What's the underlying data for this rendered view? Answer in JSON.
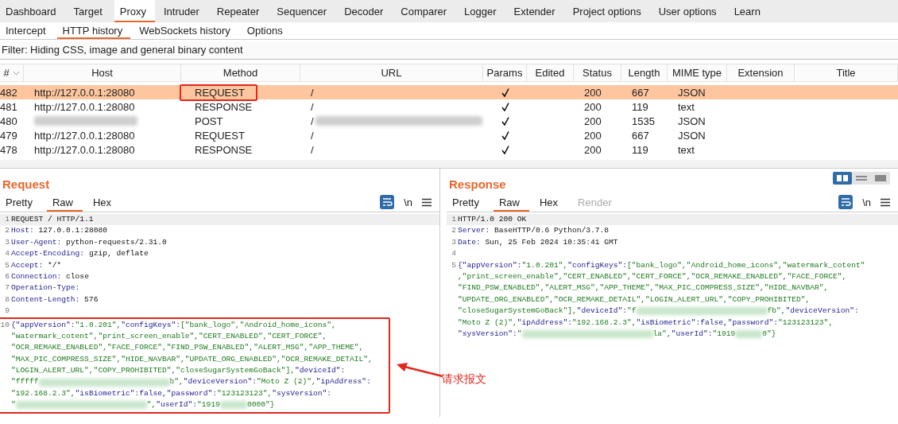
{
  "tabs": [
    {
      "label": "Dashboard",
      "selected": false
    },
    {
      "label": "Target",
      "selected": false
    },
    {
      "label": "Proxy",
      "selected": true
    },
    {
      "label": "Intruder",
      "selected": false
    },
    {
      "label": "Repeater",
      "selected": false
    },
    {
      "label": "Sequencer",
      "selected": false
    },
    {
      "label": "Decoder",
      "selected": false
    },
    {
      "label": "Comparer",
      "selected": false
    },
    {
      "label": "Logger",
      "selected": false
    },
    {
      "label": "Extender",
      "selected": false
    },
    {
      "label": "Project options",
      "selected": false
    },
    {
      "label": "User options",
      "selected": false
    },
    {
      "label": "Learn",
      "selected": false
    }
  ],
  "subtabs": [
    {
      "label": "Intercept",
      "selected": false
    },
    {
      "label": "HTTP history",
      "selected": true
    },
    {
      "label": "WebSockets history",
      "selected": false
    },
    {
      "label": "Options",
      "selected": false
    }
  ],
  "filter": "Filter: Hiding CSS, image and general binary content",
  "table": {
    "columns": [
      "#",
      "Host",
      "Method",
      "URL",
      "Params",
      "Edited",
      "Status",
      "Length",
      "MIME type",
      "Extension",
      "Title"
    ],
    "rows": [
      {
        "num": "482",
        "host": "http://127.0.0.1:28080",
        "method": "REQUEST",
        "url": "/",
        "params": true,
        "status": "200",
        "length": "667",
        "mime": "JSON",
        "selected": true,
        "method_boxed": true
      },
      {
        "num": "481",
        "host": "http://127.0.0.1:28080",
        "method": "RESPONSE",
        "url": "/",
        "params": true,
        "status": "200",
        "length": "119",
        "mime": "text",
        "selected": false,
        "method_boxed": false
      },
      {
        "num": "480",
        "host_blurred": true,
        "method": "POST",
        "url": "/",
        "url_blurred": true,
        "params": true,
        "status": "200",
        "length": "1535",
        "mime": "JSON",
        "selected": false,
        "method_boxed": false
      },
      {
        "num": "479",
        "host": "http://127.0.0.1:28080",
        "method": "REQUEST",
        "url": "/",
        "params": true,
        "status": "200",
        "length": "667",
        "mime": "JSON",
        "selected": false,
        "method_boxed": false
      },
      {
        "num": "478",
        "host": "http://127.0.0.1:28080",
        "method": "RESPONSE",
        "url": "/",
        "params": true,
        "status": "200",
        "length": "119",
        "mime": "text",
        "selected": false,
        "method_boxed": false
      }
    ]
  },
  "request": {
    "title": "Request",
    "tabs": [
      {
        "label": "Pretty",
        "selected": false,
        "disabled": false
      },
      {
        "label": "Raw",
        "selected": true,
        "disabled": false
      },
      {
        "label": "Hex",
        "selected": false,
        "disabled": false
      }
    ],
    "newline_toggle": "\\n",
    "annotation": "请求报文",
    "lines": [
      {
        "n": "1",
        "highlighted": true,
        "segs": [
          {
            "t": "REQUEST / HTTP/1.1",
            "kind": "plain"
          }
        ]
      },
      {
        "n": "2",
        "highlighted": false,
        "segs": [
          {
            "t": "Host:",
            "kind": "key"
          },
          {
            "t": " 127.0.0.1:28080",
            "kind": "plain"
          }
        ]
      },
      {
        "n": "3",
        "highlighted": false,
        "segs": [
          {
            "t": "User-Agent:",
            "kind": "key"
          },
          {
            "t": " python-requests/2.31.0",
            "kind": "plain"
          }
        ]
      },
      {
        "n": "4",
        "highlighted": false,
        "segs": [
          {
            "t": "Accept-Encoding:",
            "kind": "key"
          },
          {
            "t": " gzip, deflate",
            "kind": "plain"
          }
        ]
      },
      {
        "n": "5",
        "highlighted": false,
        "segs": [
          {
            "t": "Accept:",
            "kind": "key"
          },
          {
            "t": " */*",
            "kind": "plain"
          }
        ]
      },
      {
        "n": "6",
        "highlighted": false,
        "segs": [
          {
            "t": "Connection:",
            "kind": "key"
          },
          {
            "t": " close",
            "kind": "plain"
          }
        ]
      },
      {
        "n": "7",
        "highlighted": false,
        "segs": [
          {
            "t": "Operation-Type:",
            "kind": "key"
          }
        ]
      },
      {
        "n": "8",
        "highlighted": false,
        "segs": [
          {
            "t": "Content-Length:",
            "kind": "key"
          },
          {
            "t": " 576",
            "kind": "plain"
          }
        ]
      },
      {
        "n": "9",
        "highlighted": false
      },
      {
        "n": "10",
        "highlighted": false,
        "boxed": true,
        "segs": [
          {
            "t": "{\"appVersion\":",
            "kind": "key"
          },
          {
            "t": "\"1.0.201\",",
            "kind": "str"
          },
          {
            "t": "\"configKeys\":",
            "kind": "key"
          },
          {
            "t": "[\"bank_logo\",\"Android_home_icons\",",
            "kind": "str"
          }
        ]
      },
      {
        "highlighted": false,
        "boxed": true,
        "segs": [
          {
            "t": "\"watermark_cotent\",\"print_screen_enable\",\"CERT_ENABLED\",\"CERT_FORCE\",",
            "kind": "str"
          }
        ]
      },
      {
        "highlighted": false,
        "boxed": true,
        "segs": [
          {
            "t": "\"OCR_REMAKE_ENABLED\",\"FACE_FORCE\",\"FIND_PSW_ENABLED\",\"ALERT_MSG\",\"APP_THEME\",",
            "kind": "str"
          }
        ]
      },
      {
        "highlighted": false,
        "boxed": true,
        "segs": [
          {
            "t": "\"MAX_PIC_COMPRESS_SIZE\",\"HIDE_NAVBAR\",\"UPDATE_ORG_ENABLED\",\"OCR_REMAKE_DETAIL\",",
            "kind": "str"
          }
        ]
      },
      {
        "highlighted": false,
        "boxed": true,
        "segs": [
          {
            "t": "\"LOGIN_ALERT_URL\",\"COPY_PROHIBITED\",\"closeSugarSystemGoBack\"],",
            "kind": "str"
          },
          {
            "t": "\"deviceId\":",
            "kind": "key"
          }
        ]
      },
      {
        "highlighted": false,
        "boxed": true,
        "segs": [
          {
            "t": "\"fffff",
            "kind": "str"
          },
          {
            "kind": "redact"
          },
          {
            "t": "b\",",
            "kind": "str"
          },
          {
            "t": "\"deviceVersion\":",
            "kind": "key"
          },
          {
            "t": "\"Moto Z (2)\",",
            "kind": "str"
          },
          {
            "t": "\"ipAddress\":",
            "kind": "key"
          }
        ]
      },
      {
        "highlighted": false,
        "boxed": true,
        "segs": [
          {
            "t": "\"192.168.2.3\",",
            "kind": "str"
          },
          {
            "t": "\"isBiometric\":false,",
            "kind": "key"
          },
          {
            "t": "\"password\":",
            "kind": "key"
          },
          {
            "t": "\"123123123\",",
            "kind": "str"
          },
          {
            "t": "\"sysVersion\":",
            "kind": "key"
          }
        ]
      },
      {
        "highlighted": false,
        "boxed": true,
        "segs": [
          {
            "t": "\"",
            "kind": "str"
          },
          {
            "kind": "redact"
          },
          {
            "t": "\",",
            "kind": "str"
          },
          {
            "t": "\"userId\":",
            "kind": "key"
          },
          {
            "t": "\"1919",
            "kind": "str"
          },
          {
            "kind": "smudge"
          },
          {
            "t": "0000\"}",
            "kind": "str"
          }
        ]
      }
    ]
  },
  "response": {
    "title": "Response",
    "tabs": [
      {
        "label": "Pretty",
        "selected": false,
        "disabled": false
      },
      {
        "label": "Raw",
        "selected": true,
        "disabled": false
      },
      {
        "label": "Hex",
        "selected": false,
        "disabled": false
      },
      {
        "label": "Render",
        "selected": false,
        "disabled": true
      }
    ],
    "newline_toggle": "\\n",
    "lines": [
      {
        "n": "1",
        "highlighted": true,
        "segs": [
          {
            "t": "HTTP/1.0 200 OK",
            "kind": "plain"
          }
        ]
      },
      {
        "n": "2",
        "highlighted": false,
        "segs": [
          {
            "t": "Server:",
            "kind": "key"
          },
          {
            "t": " BaseHTTP/0.6 Python/3.7.8",
            "kind": "plain"
          }
        ]
      },
      {
        "n": "3",
        "highlighted": false,
        "segs": [
          {
            "t": "Date:",
            "kind": "key"
          },
          {
            "t": " Sun, 25 Feb 2024 10:35:41 GMT",
            "kind": "plain"
          }
        ]
      },
      {
        "n": "4",
        "highlighted": false
      },
      {
        "n": "5",
        "highlighted": false,
        "segs": [
          {
            "t": "{\"appVersion\":",
            "kind": "key"
          },
          {
            "t": "\"1.0.201\",",
            "kind": "str"
          },
          {
            "t": "\"configKeys\":",
            "kind": "key"
          },
          {
            "t": "[\"bank_logo\",\"Android_home_icons\",\"watermark_cotent\"",
            "kind": "str"
          }
        ]
      },
      {
        "highlighted": false,
        "segs": [
          {
            "t": ",\"print_screen_enable\",\"CERT_ENABLED\",\"CERT_FORCE\",\"OCR_REMAKE_ENABLED\",\"FACE_FORCE\",",
            "kind": "str"
          }
        ]
      },
      {
        "highlighted": false,
        "segs": [
          {
            "t": "\"FIND_PSW_ENABLED\",\"ALERT_MSG\",\"APP_THEME\",\"MAX_PIC_COMPRESS_SIZE\",\"HIDE_NAVBAR\",",
            "kind": "str"
          }
        ]
      },
      {
        "highlighted": false,
        "segs": [
          {
            "t": "\"UPDATE_ORG_ENABLED\",\"OCR_REMAKE_DETAIL\",\"LOGIN_ALERT_URL\",\"COPY_PROHIBITED\",",
            "kind": "str"
          }
        ]
      },
      {
        "highlighted": false,
        "segs": [
          {
            "t": "\"closeSugarSystemGoBack\"],",
            "kind": "str"
          },
          {
            "t": "\"deviceId\":",
            "kind": "key"
          },
          {
            "t": "\"f",
            "kind": "str"
          },
          {
            "kind": "redact"
          },
          {
            "t": "fb\",",
            "kind": "str"
          },
          {
            "t": "\"deviceVersion\":",
            "kind": "key"
          }
        ]
      },
      {
        "highlighted": false,
        "segs": [
          {
            "t": "\"Moto Z (2)\",",
            "kind": "str"
          },
          {
            "t": "\"ipAddress\":",
            "kind": "key"
          },
          {
            "t": "\"192.168.2.3\",",
            "kind": "str"
          },
          {
            "t": "\"isBiometric\":false,",
            "kind": "key"
          },
          {
            "t": "\"password\":",
            "kind": "key"
          },
          {
            "t": "\"123123123\",",
            "kind": "str"
          }
        ]
      },
      {
        "highlighted": false,
        "segs": [
          {
            "t": "\"sysVersion\":",
            "kind": "key"
          },
          {
            "t": "\"",
            "kind": "str"
          },
          {
            "kind": "redact"
          },
          {
            "t": "la\",",
            "kind": "str"
          },
          {
            "t": "\"userId\":",
            "kind": "key"
          },
          {
            "t": "\"1919",
            "kind": "str"
          },
          {
            "kind": "smudge"
          },
          {
            "t": "0\"}",
            "kind": "str"
          }
        ]
      }
    ]
  }
}
